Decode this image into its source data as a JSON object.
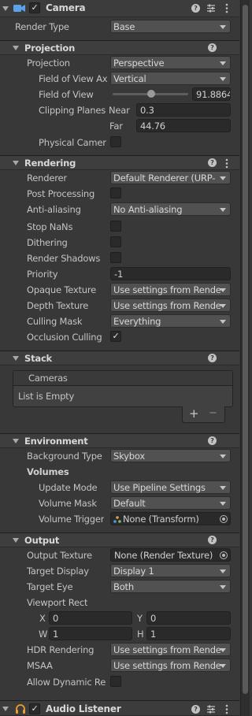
{
  "camera": {
    "title": "Camera",
    "render_type_label": "Render Type",
    "render_type_value": "Base"
  },
  "projection": {
    "title": "Projection",
    "projection_label": "Projection",
    "projection_value": "Perspective",
    "fov_axis_label": "Field of View Ax",
    "fov_axis_value": "Vertical",
    "fov_label": "Field of View",
    "fov_value": "91.8864",
    "fov_fraction": 0.51,
    "clip_label": "Clipping Planes",
    "near_label": "Near",
    "near_value": "0.3",
    "far_label": "Far",
    "far_value": "44.76",
    "physical_label": "Physical Camer"
  },
  "rendering": {
    "title": "Rendering",
    "renderer_label": "Renderer",
    "renderer_value": "Default Renderer (URP-",
    "post_label": "Post Processing",
    "aa_label": "Anti-aliasing",
    "aa_value": "No Anti-aliasing",
    "stopnan_label": "Stop NaNs",
    "dither_label": "Dithering",
    "shadows_label": "Render Shadows",
    "priority_label": "Priority",
    "priority_value": "-1",
    "opaque_label": "Opaque Texture",
    "opaque_value": "Use settings from Rende",
    "depth_label": "Depth Texture",
    "depth_value": "Use settings from Rende",
    "mask_label": "Culling Mask",
    "mask_value": "Everything",
    "occlusion_label": "Occlusion Culling"
  },
  "stack": {
    "title": "Stack",
    "cameras_label": "Cameras",
    "empty_text": "List is Empty"
  },
  "environment": {
    "title": "Environment",
    "bg_label": "Background Type",
    "bg_value": "Skybox",
    "volumes_label": "Volumes",
    "update_label": "Update Mode",
    "update_value": "Use Pipeline Settings",
    "vmask_label": "Volume Mask",
    "vmask_value": "Default",
    "trigger_label": "Volume Trigger",
    "trigger_value": "None (Transform)"
  },
  "output": {
    "title": "Output",
    "tex_label": "Output Texture",
    "tex_value": "None (Render Texture)",
    "display_label": "Target Display",
    "display_value": "Display 1",
    "eye_label": "Target Eye",
    "eye_value": "Both",
    "viewport_label": "Viewport Rect",
    "x_label": "X",
    "x_value": "0",
    "y_label": "Y",
    "y_value": "0",
    "w_label": "W",
    "w_value": "1",
    "h_label": "H",
    "h_value": "1",
    "hdr_label": "HDR Rendering",
    "hdr_value": "Use settings from Rende",
    "msaa_label": "MSAA",
    "msaa_value": "Use settings from Rende",
    "dynres_label": "Allow Dynamic Re"
  },
  "audio": {
    "title": "Audio Listener"
  },
  "icons": {
    "checkmark": "✓",
    "help": "?",
    "plus": "+",
    "minus": "−"
  }
}
